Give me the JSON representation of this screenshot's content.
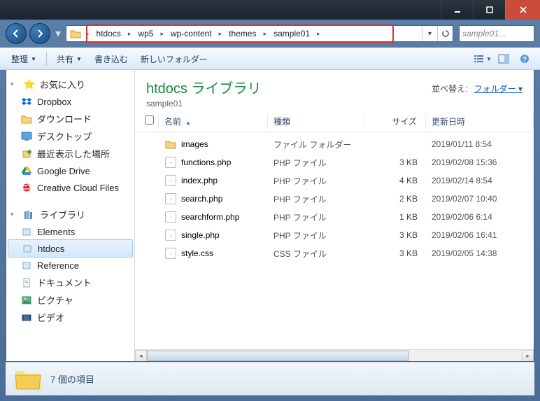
{
  "breadcrumb": [
    "htdocs",
    "wp5",
    "wp-content",
    "themes",
    "sample01"
  ],
  "search": {
    "placeholder": "sample01..."
  },
  "toolbar": {
    "organize": "整理",
    "share": "共有",
    "write": "書き込む",
    "newfolder": "新しいフォルダー"
  },
  "sidebar": {
    "favorites": {
      "label": "お気に入り",
      "items": [
        "Dropbox",
        "ダウンロード",
        "デスクトップ",
        "最近表示した場所",
        "Google Drive",
        "Creative Cloud Files"
      ]
    },
    "libraries": {
      "label": "ライブラリ",
      "items": [
        "Elements",
        "htdocs",
        "Reference",
        "ドキュメント",
        "ピクチャ",
        "ビデオ"
      ]
    }
  },
  "library": {
    "title": "htdocs ライブラリ",
    "subtitle": "sample01",
    "arrange_label": "並べ替え:",
    "arrange_value": "フォルダー"
  },
  "columns": {
    "name": "名前",
    "type": "種類",
    "size": "サイズ",
    "date": "更新日時"
  },
  "files": [
    {
      "name": "images",
      "type": "ファイル フォルダー",
      "size": "",
      "date": "2019/01/11 8:54",
      "icon": "folder"
    },
    {
      "name": "functions.php",
      "type": "PHP ファイル",
      "size": "3 KB",
      "date": "2019/02/08 15:36",
      "icon": "php"
    },
    {
      "name": "index.php",
      "type": "PHP ファイル",
      "size": "4 KB",
      "date": "2019/02/14 8:54",
      "icon": "php"
    },
    {
      "name": "search.php",
      "type": "PHP ファイル",
      "size": "2 KB",
      "date": "2019/02/07 10:40",
      "icon": "php"
    },
    {
      "name": "searchform.php",
      "type": "PHP ファイル",
      "size": "1 KB",
      "date": "2019/02/06 6:14",
      "icon": "php"
    },
    {
      "name": "single.php",
      "type": "PHP ファイル",
      "size": "3 KB",
      "date": "2019/02/06 16:41",
      "icon": "php"
    },
    {
      "name": "style.css",
      "type": "CSS ファイル",
      "size": "3 KB",
      "date": "2019/02/05 14:38",
      "icon": "css"
    }
  ],
  "status": {
    "text": "7 個の項目"
  }
}
